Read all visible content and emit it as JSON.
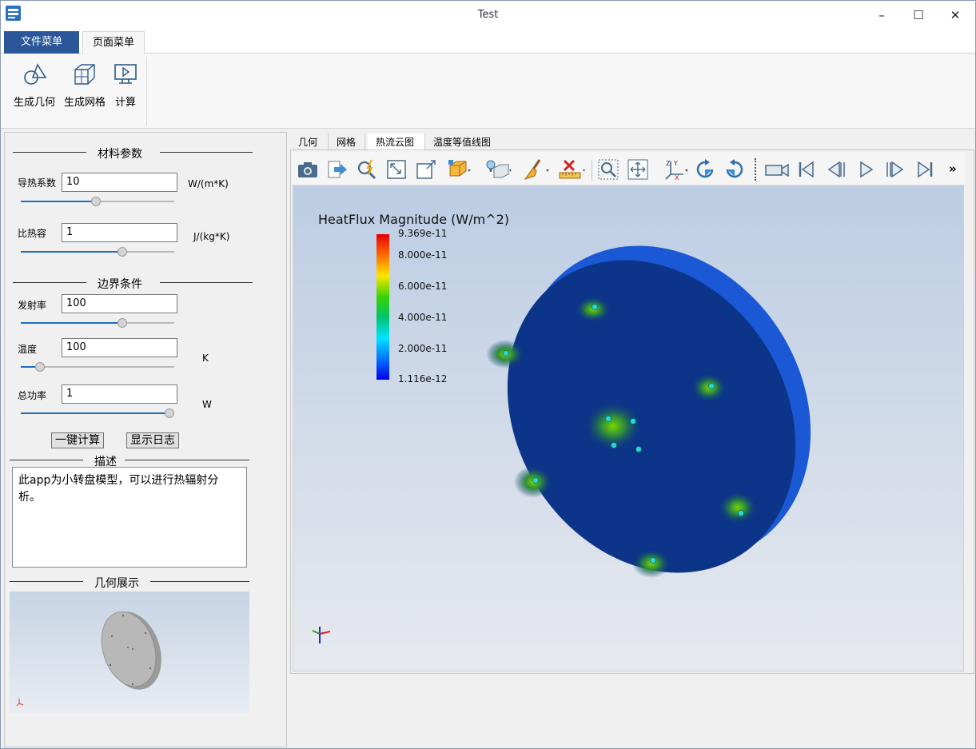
{
  "window": {
    "title": "Test"
  },
  "menu": {
    "tabs": [
      "文件菜单",
      "页面菜单"
    ]
  },
  "ribbon": {
    "buttons": [
      {
        "label": "生成几何",
        "icon": "geometry-icon"
      },
      {
        "label": "生成网格",
        "icon": "mesh-icon"
      },
      {
        "label": "计算",
        "icon": "compute-icon"
      }
    ]
  },
  "left": {
    "material_title": "材料参数",
    "boundary_title": "边界条件",
    "desc_title": "描述",
    "geo_title": "几何展示",
    "fields": [
      {
        "label": "导热系数",
        "value": "10",
        "unit": "W/(m*K)",
        "slider": 0.49
      },
      {
        "label": "比热容",
        "value": "1",
        "unit": "J/(kg*K)",
        "slider": 0.67
      },
      {
        "label": "发射率",
        "value": "100",
        "unit": "",
        "slider": 0.67
      },
      {
        "label": "温度",
        "value": "100",
        "unit": "K",
        "slider": 0.1
      },
      {
        "label": "总功率",
        "value": "1",
        "unit": "W",
        "slider": 1.0
      }
    ],
    "btn_compute": "一键计算",
    "btn_log": "显示日志",
    "description": "此app为小转盘模型，可以进行热辐射分析。"
  },
  "view": {
    "tabs": [
      "几何",
      "网格",
      "热流云图",
      "温度等值线图"
    ],
    "legend_title": "HeatFlux Magnitude (W/m^2)",
    "legend_ticks": [
      "9.369e-11",
      "8.000e-11",
      "6.000e-11",
      "4.000e-11",
      "2.000e-11",
      "1.116e-12"
    ],
    "toolbar_icons": [
      "camera-icon",
      "export-icon",
      "probe-icon",
      "zoom-box-icon",
      "zoom-fit-icon",
      "box-view-icon",
      "light-icon",
      "reset-view-icon",
      "brush-icon",
      "ruler-icon",
      "zoom-region-icon",
      "pan-icon",
      "axes-icon",
      "rotate-cw-icon",
      "rotate-ccw-icon",
      "record-icon",
      "first-frame-icon",
      "prev-frame-icon",
      "play-icon",
      "next-frame-icon",
      "last-frame-icon",
      "more-icon"
    ],
    "more_label": "»"
  }
}
